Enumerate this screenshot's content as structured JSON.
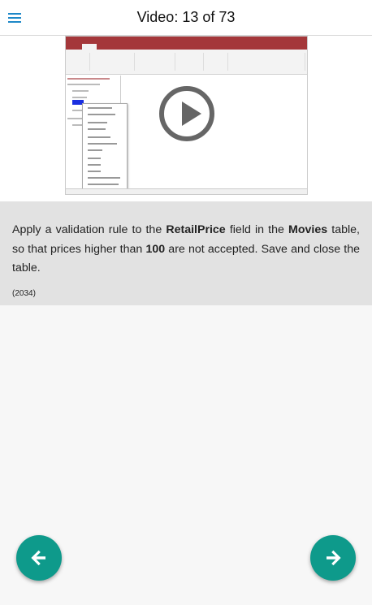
{
  "header": {
    "menu_icon": "hamburger-menu-icon",
    "title": "Video: 13 of 73"
  },
  "video": {
    "play_icon": "play-icon"
  },
  "task": {
    "segments": [
      {
        "text": "Apply a validation rule to the ",
        "bold": false
      },
      {
        "text": "RetailPrice",
        "bold": true
      },
      {
        "text": " field in the ",
        "bold": false
      },
      {
        "text": "Movies",
        "bold": true
      },
      {
        "text": " table, so that prices higher than ",
        "bold": false
      },
      {
        "text": "100",
        "bold": true
      },
      {
        "text": " are not accepted. Save and close the table.",
        "bold": false
      }
    ],
    "id_label": "(2034)"
  },
  "nav": {
    "prev_icon": "arrow-left-icon",
    "next_icon": "arrow-right-icon",
    "accent": "#0e9a8b"
  },
  "colors": {
    "header_icon": "#1e88c8",
    "task_background": "#e2e2e2",
    "access_brand": "#a4373a"
  }
}
